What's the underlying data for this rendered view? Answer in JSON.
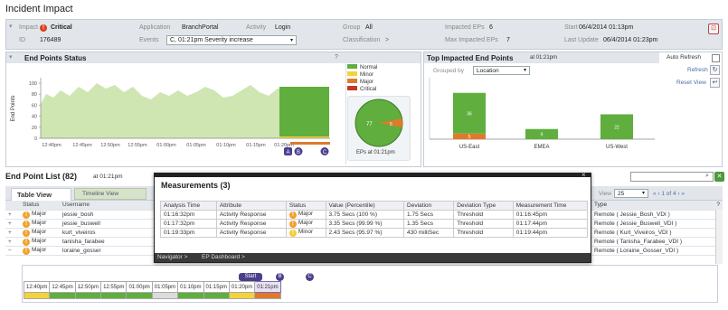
{
  "page_title": "Incident Impact",
  "header": {
    "impact_label": "Impact",
    "impact_value": "Critical",
    "id_label": "ID",
    "id_value": "176489",
    "application_label": "Application",
    "application_value": "BranchPortal",
    "activity_label": "Activity",
    "activity_value": "Login",
    "events_label": "Events",
    "events_value": "C, 01:21pm Severity increase",
    "group_label": "Group",
    "group_value": "All",
    "classification_label": "Classification",
    "classification_arrow": ">",
    "impacted_eps_label": "Impacted EPs",
    "impacted_eps_value": "6",
    "max_impacted_eps_label": "Max Impacted EPs",
    "max_impacted_eps_value": "7",
    "start_label": "Start",
    "start_value": "06/4/2014 01:13pm",
    "last_update_label": "Last Update",
    "last_update_value": "06/4/2014 01:23pm"
  },
  "status_panel": {
    "title": "End Points Status",
    "help": "?",
    "ylabel": "End Points",
    "yticks": [
      "100",
      "80",
      "60",
      "40",
      "20",
      "0"
    ],
    "xticks": [
      "12:40pm",
      "12:45pm",
      "12:50pm",
      "12:55pm",
      "01:00pm",
      "01:05pm",
      "01:10pm",
      "01:15pm",
      "01:20pm"
    ],
    "markers": [
      "A",
      "B",
      "C"
    ],
    "legend": [
      "Normal",
      "Minor",
      "Major",
      "Critical"
    ],
    "pie_normal": "77",
    "pie_major": "5",
    "pie_caption": "EPs at 01:21pm"
  },
  "top_panel": {
    "title": "Top Impacted End Points",
    "title_suffix": "at 01:21pm",
    "grouped_by_label": "Grouped by",
    "grouped_by_value": "Location",
    "auto_refresh": "Auto Refresh",
    "refresh": "Refresh",
    "reset_view": "Reset View"
  },
  "chart_data": {
    "type": "bar",
    "categories": [
      "US-East",
      "EMEA",
      "US-West"
    ],
    "series": [
      {
        "name": "Normal",
        "values": [
          36,
          9,
          22
        ]
      },
      {
        "name": "Major",
        "values": [
          5,
          0,
          0
        ]
      }
    ]
  },
  "colors": {
    "normal": "#5fae3e",
    "minor": "#f3d23a",
    "major": "#e07a2a",
    "critical": "#c0392b",
    "area": "#cfe6b3"
  },
  "list": {
    "title": "End Point List (82)",
    "title_suffix": "at 01:21pm",
    "tab_table": "Table View",
    "tab_timeline": "Timeline View",
    "col_status": "Status",
    "col_username": "Username",
    "col_type": "Type",
    "view_label": "View",
    "view_value": "25",
    "pager": "« ‹ 1 of 4 › »",
    "help": "?",
    "rows": [
      {
        "expand": "+",
        "status": "Major",
        "username": "jessie_bosh",
        "type": "Remote ( Jessie_Bosh_VDI )"
      },
      {
        "expand": "+",
        "status": "Major",
        "username": "jessie_buswell",
        "type": "Remote ( Jessie_Buswell_VDI )"
      },
      {
        "expand": "+",
        "status": "Major",
        "username": "kurt_viveiros",
        "type": "Remote ( Kurt_Viveiros_VDI )"
      },
      {
        "expand": "+",
        "status": "Major",
        "username": "tanisha_farabee",
        "type": "Remote ( Tanisha_Farabee_VDI )"
      },
      {
        "expand": "−",
        "status": "Major",
        "username": "loraine_gosser",
        "type": "Remote ( Loraine_Gosser_VDI )"
      }
    ]
  },
  "modal": {
    "title": "Measurements (3)",
    "close": "×",
    "headers": [
      "Analysis Time",
      "Attribute",
      "Status",
      "Value (Percentile)",
      "Deviation",
      "Deviation Type",
      "Measurement Time"
    ],
    "rows": [
      {
        "time": "01:16:32pm",
        "attr": "Activity Response",
        "status": "Major",
        "value": "3.75 Secs (100 %)",
        "dev": "1.75 Secs",
        "dtype": "Threshold",
        "mtime": "01:16:45pm"
      },
      {
        "time": "01:17:32pm",
        "attr": "Activity Response",
        "status": "Major",
        "value": "3.35 Secs (99.99 %)",
        "dev": "1.35 Secs",
        "dtype": "Threshold",
        "mtime": "01:17:44pm"
      },
      {
        "time": "01:19:33pm",
        "attr": "Activity Response",
        "status": "Minor",
        "value": "2.43 Secs (95.97 %)",
        "dev": "430 milliSec",
        "dtype": "Threshold",
        "mtime": "01:19:44pm"
      }
    ],
    "navigator": "Navigator >",
    "ep_dashboard": "EP Dashboard >"
  },
  "timeline": {
    "times": [
      "12:40pm",
      "12:45pm",
      "12:50pm",
      "12:55pm",
      "01:00pm",
      "01:05pm",
      "01:10pm",
      "01:15pm",
      "01:20pm",
      "01:21pm"
    ],
    "colors": [
      "#f3d23a",
      "#5fae3e",
      "#5fae3e",
      "#5fae3e",
      "#5fae3e",
      "#dcdcdc",
      "#5fae3e",
      "#5fae3e",
      "#f3d23a",
      "#e07a2a"
    ],
    "start_badge": "Start",
    "badge_b": "B",
    "badge_c": "C"
  }
}
